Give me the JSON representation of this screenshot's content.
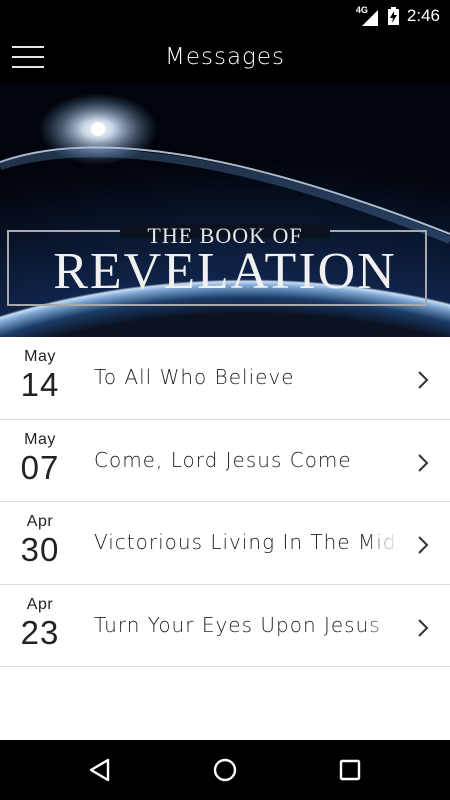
{
  "status_bar": {
    "network": "4G",
    "time": "2:46"
  },
  "app_bar": {
    "title": "Messages"
  },
  "banner": {
    "line1": "THE BOOK OF",
    "line2": "REVELATION"
  },
  "messages": [
    {
      "month": "May",
      "day": "14",
      "title": "To All Who Believe"
    },
    {
      "month": "May",
      "day": "07",
      "title": "Come, Lord Jesus Come"
    },
    {
      "month": "Apr",
      "day": "30",
      "title": "Victorious Living In The Midst"
    },
    {
      "month": "Apr",
      "day": "23",
      "title": "Turn Your Eyes Upon Jesus"
    }
  ],
  "icons": {
    "menu": "hamburger-menu-icon",
    "chevron": "chevron-right-icon",
    "back": "back-triangle-icon",
    "home": "home-circle-icon",
    "recents": "recents-square-icon"
  },
  "colors": {
    "bar_background": "#000000",
    "list_background": "#ffffff",
    "divider": "#dddddd",
    "text": "#222222"
  }
}
